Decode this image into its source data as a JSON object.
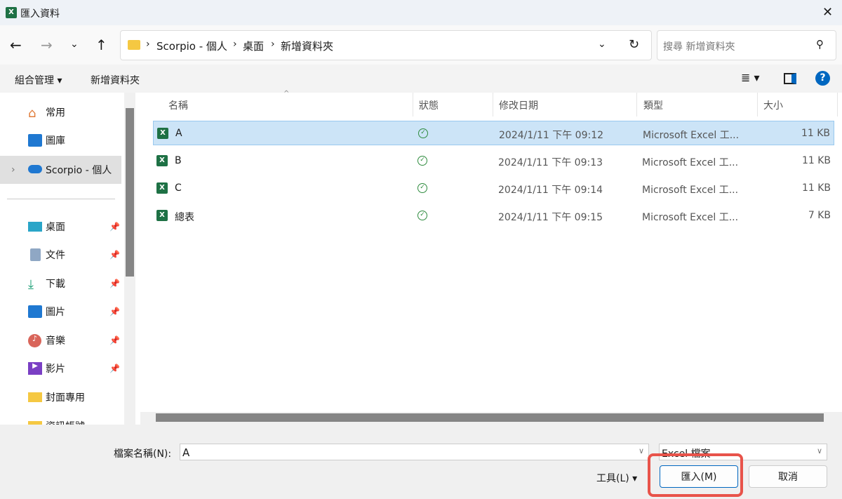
{
  "window": {
    "title": "匯入資料",
    "close": "✕"
  },
  "nav": {
    "breadcrumb": [
      "Scorpio - 個人",
      "桌面",
      "新增資料夾"
    ],
    "search_placeholder": "搜尋 新增資料夾"
  },
  "toolbar": {
    "organize": "組合管理",
    "new_folder": "新增資料夾"
  },
  "sidebar": {
    "items": [
      {
        "label": "常用",
        "icon": "home-icon"
      },
      {
        "label": "圖庫",
        "icon": "gallery-icon"
      },
      {
        "label": "Scorpio - 個人",
        "icon": "onedrive-icon"
      },
      {
        "label": "桌面",
        "icon": "desktop-icon",
        "pinned": true
      },
      {
        "label": "文件",
        "icon": "documents-icon",
        "pinned": true
      },
      {
        "label": "下載",
        "icon": "download-icon",
        "pinned": true
      },
      {
        "label": "圖片",
        "icon": "pictures-icon",
        "pinned": true
      },
      {
        "label": "音樂",
        "icon": "music-icon",
        "pinned": true
      },
      {
        "label": "影片",
        "icon": "videos-icon",
        "pinned": true
      },
      {
        "label": "封面專用",
        "icon": "folder-icon"
      },
      {
        "label": "資訊帳號",
        "icon": "folder-icon"
      }
    ]
  },
  "columns": [
    "名稱",
    "狀態",
    "修改日期",
    "類型",
    "大小"
  ],
  "files": [
    {
      "name": "A",
      "date": "2024/1/11 下午 09:12",
      "type": "Microsoft Excel 工...",
      "size": "11 KB",
      "selected": true
    },
    {
      "name": "B",
      "date": "2024/1/11 下午 09:13",
      "type": "Microsoft Excel 工...",
      "size": "11 KB"
    },
    {
      "name": "C",
      "date": "2024/1/11 下午 09:14",
      "type": "Microsoft Excel 工...",
      "size": "11 KB"
    },
    {
      "name": "總表",
      "date": "2024/1/11 下午 09:15",
      "type": "Microsoft Excel 工...",
      "size": "7 KB"
    }
  ],
  "footer": {
    "filename_label": "檔案名稱(N):",
    "filename_value": "A",
    "filetype": "Excel 檔案",
    "tools": "工具(L)",
    "import": "匯入(M)",
    "cancel": "取消"
  },
  "colors": {
    "accent": "#0067c0",
    "highlight": "#e8534a",
    "selection": "#cce4f7"
  }
}
